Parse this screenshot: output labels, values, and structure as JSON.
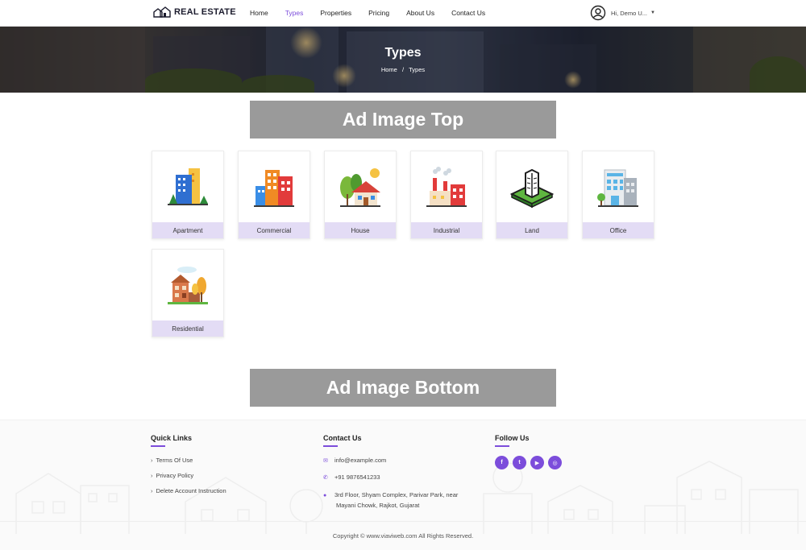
{
  "header": {
    "logo_text": "REAL ESTATE",
    "nav": [
      {
        "label": "Home",
        "active": false
      },
      {
        "label": "Types",
        "active": true
      },
      {
        "label": "Properties",
        "active": false
      },
      {
        "label": "Pricing",
        "active": false
      },
      {
        "label": "About Us",
        "active": false
      },
      {
        "label": "Contact Us",
        "active": false
      }
    ],
    "user_label": "Hi, Demo U...",
    "user_icon": "user-circle-icon"
  },
  "hero": {
    "title": "Types",
    "breadcrumb": {
      "home": "Home",
      "separator": "/",
      "current": "Types"
    }
  },
  "ads": {
    "top": "Ad Image Top",
    "bottom": "Ad Image Bottom"
  },
  "types": [
    {
      "label": "Apartment",
      "icon": "apartment-icon"
    },
    {
      "label": "Commercial",
      "icon": "commercial-icon"
    },
    {
      "label": "House",
      "icon": "house-icon"
    },
    {
      "label": "Industrial",
      "icon": "industrial-icon"
    },
    {
      "label": "Land",
      "icon": "land-icon"
    },
    {
      "label": "Office",
      "icon": "office-icon"
    },
    {
      "label": "Residential",
      "icon": "residential-icon"
    }
  ],
  "footer": {
    "quick_links": {
      "heading": "Quick Links",
      "items": [
        "Terms Of Use",
        "Privacy Policy",
        "Delete Account Instruction"
      ]
    },
    "contact": {
      "heading": "Contact Us",
      "email": "info@example.com",
      "phone": "+91 9876541233",
      "address_line1": "3rd Floor, Shyam Complex, Parivar Park, near",
      "address_line2": "Mayani Chowk, Rajkot, Gujarat"
    },
    "follow": {
      "heading": "Follow Us",
      "social": [
        {
          "icon": "facebook-icon",
          "glyph": "f"
        },
        {
          "icon": "twitter-icon",
          "glyph": "t"
        },
        {
          "icon": "youtube-icon",
          "glyph": "▶"
        },
        {
          "icon": "instagram-icon",
          "glyph": "◎"
        }
      ]
    },
    "copyright": "Copyright © www.viaviweb.com All Rights Reserved."
  },
  "colors": {
    "accent": "#7c4ddb",
    "card_label_bg": "#e3dcf5",
    "ad_bg": "#9a9a9a"
  }
}
